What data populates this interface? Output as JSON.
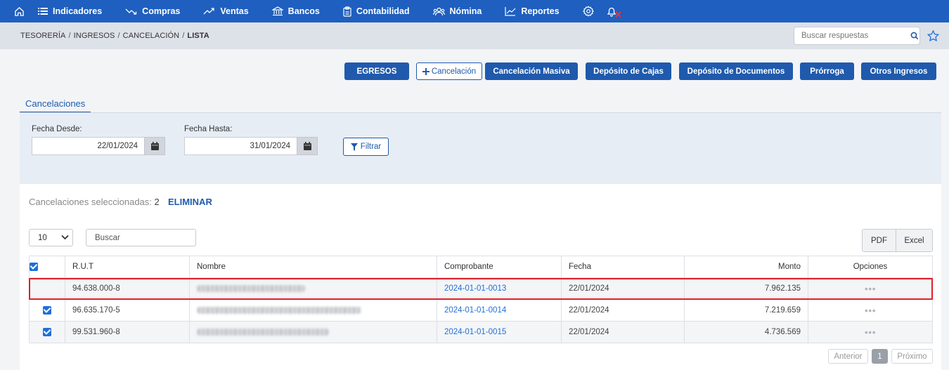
{
  "nav": {
    "items": [
      {
        "label": "Indicadores",
        "icon": "list-icon"
      },
      {
        "label": "Compras",
        "icon": "trend-down-icon"
      },
      {
        "label": "Ventas",
        "icon": "trend-up-icon"
      },
      {
        "label": "Bancos",
        "icon": "bank-icon"
      },
      {
        "label": "Contabilidad",
        "icon": "clipboard-icon"
      },
      {
        "label": "Nómina",
        "icon": "users-icon"
      },
      {
        "label": "Reportes",
        "icon": "chart-line-icon"
      }
    ],
    "color": "#1f5fbf"
  },
  "breadcrumb": {
    "items": [
      "TESORERÍA",
      "INGRESOS",
      "CANCELACIÓN"
    ],
    "current": "LISTA",
    "separator": "/"
  },
  "help_search": {
    "placeholder": "Buscar respuestas"
  },
  "actions": {
    "egresos": "EGRESOS",
    "cancelacion": "Cancelación",
    "cancelacion_masiva": "Cancelación Masiva",
    "deposito_cajas": "Depósito de Cajas",
    "deposito_documentos": "Depósito de Documentos",
    "prorroga": "Prórroga",
    "otros_ingresos": "Otros Ingresos"
  },
  "tab": {
    "label": "Cancelaciones"
  },
  "filter": {
    "desde_label": "Fecha Desde:",
    "desde_value": "22/01/2024",
    "hasta_label": "Fecha Hasta:",
    "hasta_value": "31/01/2024",
    "button": "Filtrar"
  },
  "selection": {
    "label": "Cancelaciones seleccionadas:",
    "count": "2",
    "delete": "ELIMINAR"
  },
  "table_controls": {
    "page_size": "10",
    "search_placeholder": "Buscar",
    "pdf": "PDF",
    "excel": "Excel"
  },
  "table": {
    "headers": {
      "rut": "R.U.T",
      "nombre": "Nombre",
      "comprobante": "Comprobante",
      "fecha": "Fecha",
      "monto": "Monto",
      "opciones": "Opciones"
    },
    "rows": [
      {
        "checked": false,
        "rut": "94.638.000-8",
        "comprobante": "2024-01-01-0013",
        "fecha": "22/01/2024",
        "monto": "7.962.135",
        "options": "•••"
      },
      {
        "checked": true,
        "rut": "96.635.170-5",
        "comprobante": "2024-01-01-0014",
        "fecha": "22/01/2024",
        "monto": "7.219.659",
        "options": "•••"
      },
      {
        "checked": true,
        "rut": "99.531.960-8",
        "comprobante": "2024-01-01-0015",
        "fecha": "22/01/2024",
        "monto": "4.736.569",
        "options": "•••"
      }
    ]
  },
  "pager": {
    "prev": "Anterior",
    "page": "1",
    "next": "Próximo"
  },
  "colors": {
    "primary": "#1f5aad",
    "highlight": "#e0202a",
    "link": "#1f6fd8"
  }
}
